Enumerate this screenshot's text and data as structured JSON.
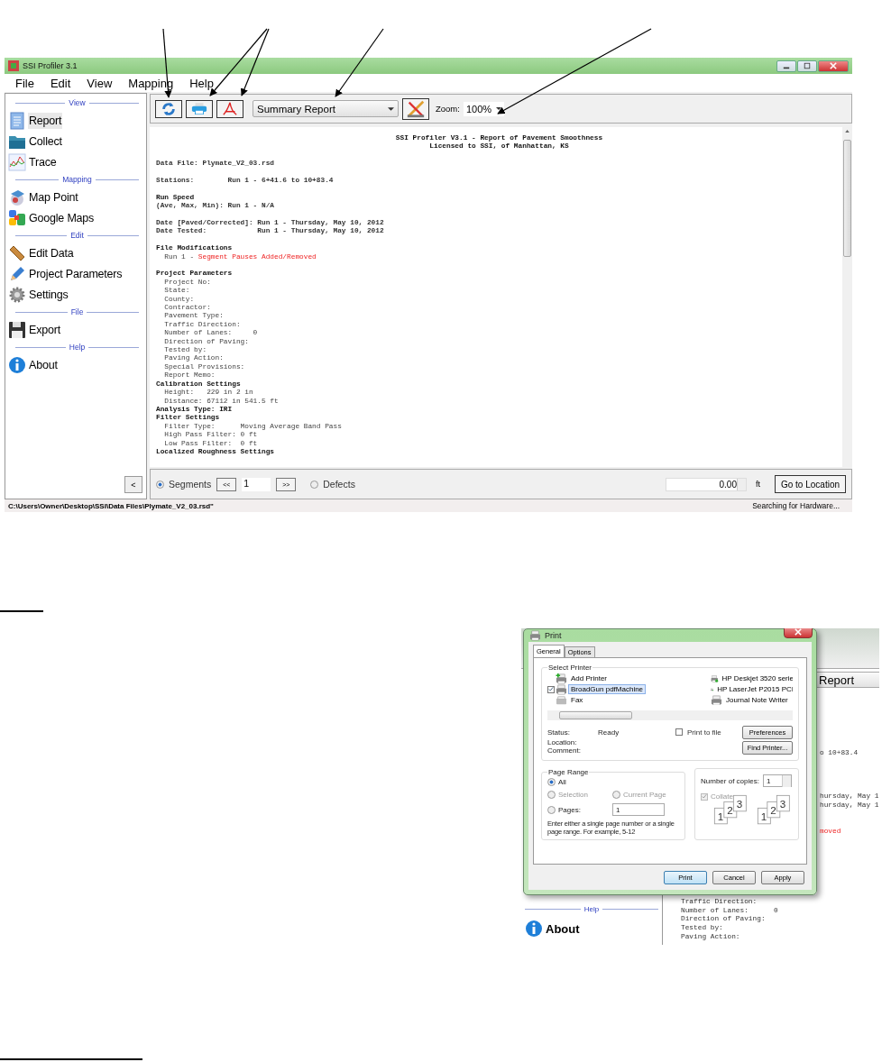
{
  "window": {
    "title": "SSI Profiler 3.1"
  },
  "menu": [
    "File",
    "Edit",
    "View",
    "Mapping",
    "Help"
  ],
  "sidebar": {
    "sections": [
      {
        "title": "View",
        "items": [
          {
            "label": "Report",
            "kind": "document",
            "selected": true
          },
          {
            "label": "Collect",
            "kind": "folder",
            "selected": false
          },
          {
            "label": "Trace",
            "kind": "chart",
            "selected": false
          }
        ]
      },
      {
        "title": "Mapping",
        "items": [
          {
            "label": "Map Point",
            "kind": "globe",
            "selected": false
          },
          {
            "label": "Google Maps",
            "kind": "blocks",
            "selected": false
          }
        ]
      },
      {
        "title": "Edit",
        "items": [
          {
            "label": "Edit Data",
            "kind": "ruler",
            "selected": false
          },
          {
            "label": "Project Parameters",
            "kind": "pencil",
            "selected": false
          },
          {
            "label": "Settings",
            "kind": "gear",
            "selected": false
          }
        ]
      },
      {
        "title": "File",
        "items": [
          {
            "label": "Export",
            "kind": "floppy",
            "selected": false
          }
        ]
      },
      {
        "title": "Help",
        "items": [
          {
            "label": "About",
            "kind": "info",
            "selected": false
          }
        ]
      }
    ],
    "collapse_button": "<"
  },
  "toolbar": {
    "buttons": [
      {
        "kind": "refresh"
      },
      {
        "kind": "print"
      },
      {
        "kind": "pdf"
      }
    ],
    "report_select": "Summary Report",
    "tool_button": {
      "kind": "drafting"
    },
    "zoom_label": "Zoom:",
    "zoom_value": "100%"
  },
  "report": {
    "blocks": [
      {
        "lines": [
          {
            "kind": "title",
            "text": "SSI Profiler V3.1 - Report of Pavement Smoothness"
          },
          {
            "kind": "title",
            "text": "Licensed to SSI, of Manhattan, KS"
          }
        ]
      },
      {
        "lines": [
          {
            "kind": "line",
            "text": "Data File: Plymate_V2_03.rsd"
          }
        ]
      },
      {
        "lines": [
          {
            "kind": "line",
            "text": "Stations:        Run 1 - 6+41.6 to 10+83.4"
          }
        ]
      },
      {
        "lines": [
          {
            "kind": "heading",
            "text": "Run Speed"
          },
          {
            "kind": "line",
            "text": "(Ave, Max, Min): Run 1 - N/A"
          }
        ]
      },
      {
        "lines": [
          {
            "kind": "line",
            "text": "Date [Paved/Corrected]: Run 1 - Thursday, May 10, 2012"
          },
          {
            "kind": "line",
            "text": "Date Tested:            Run 1 - Thursday, May 10, 2012"
          }
        ]
      },
      {
        "lines": [
          {
            "kind": "heading",
            "text": "File Modifications"
          },
          {
            "kind": "sub",
            "text": "Run 1 - ",
            "flag": "Segment Pauses Added/Removed"
          }
        ]
      },
      {
        "lines": [
          {
            "kind": "heading",
            "text": "Project Parameters"
          },
          {
            "kind": "sub",
            "text": "Project No:"
          },
          {
            "kind": "sub",
            "text": "State:"
          },
          {
            "kind": "sub",
            "text": "County:"
          },
          {
            "kind": "sub",
            "text": "Contractor:"
          },
          {
            "kind": "sub",
            "text": "Pavement Type:"
          },
          {
            "kind": "sub",
            "text": "Traffic Direction:"
          },
          {
            "kind": "sub",
            "text": "Number of Lanes:     0"
          },
          {
            "kind": "sub",
            "text": "Direction of Paving:"
          },
          {
            "kind": "sub",
            "text": "Tested by:"
          },
          {
            "kind": "sub",
            "text": "Paving Action:"
          },
          {
            "kind": "sub",
            "text": "Special Provisions:"
          },
          {
            "kind": "sub",
            "text": "Report Memo:"
          },
          {
            "kind": "heading",
            "text": "Calibration Settings"
          },
          {
            "kind": "sub",
            "text": "Height:   229 in 2 in"
          },
          {
            "kind": "sub",
            "text": "Distance: 67112 in 541.5 ft"
          },
          {
            "kind": "heading",
            "text": "Analysis Type: IRI"
          },
          {
            "kind": "heading",
            "text": "Filter Settings"
          },
          {
            "kind": "sub",
            "text": "Filter Type:      Moving Average Band Pass"
          },
          {
            "kind": "sub",
            "text": "High Pass Filter: 0 ft"
          },
          {
            "kind": "sub",
            "text": "Low Pass Filter:  0 ft"
          },
          {
            "kind": "heading",
            "text": "Localized Roughness Settings"
          }
        ]
      }
    ]
  },
  "navigation": {
    "segments": {
      "label": "Segments",
      "selected": true
    },
    "prev": "<<",
    "page": "1",
    "next": ">>",
    "defects": {
      "label": "Defects",
      "selected": false
    },
    "location": "0.00",
    "unit": "ft",
    "go_button": "Go to Location"
  },
  "status_bar": {
    "path": "C:\\Users\\Owner\\Desktop\\SSI\\Data Files\\Plymate_V2_03.rsd\"",
    "status": "Searching for Hardware..."
  },
  "print_screenshot": {
    "app": {
      "report_select": "Report",
      "fragments": [
        {
          "text": "o 10+83.4",
          "flagged": false
        },
        {
          "text": "hursday, May 1",
          "flagged": false
        },
        {
          "text": "hursday, May 1",
          "flagged": false
        },
        {
          "text": "moved",
          "flagged": true
        }
      ],
      "help_label": "Help",
      "about_label": "About",
      "lines": [
        "Traffic Direction:",
        "Number of Lanes:      0",
        "Direction of Paving:",
        "Tested by:",
        "Paving Action:"
      ]
    },
    "dialog": {
      "title": "Print",
      "tabs": [
        {
          "label": "General",
          "selected": true
        },
        {
          "label": "Options",
          "selected": false
        }
      ],
      "printer_group": "Select Printer",
      "printers": [
        {
          "label": "Add Printer",
          "kind": "add",
          "selected": false,
          "default": false
        },
        {
          "label": "BroadGun pdfMachine",
          "kind": "printer",
          "selected": true,
          "default": true
        },
        {
          "label": "Fax",
          "kind": "fax",
          "selected": false,
          "default": false
        },
        {
          "label": "HP Deskjet 3520 serie",
          "kind": "network",
          "selected": false,
          "default": false
        },
        {
          "label": "HP LaserJet P2015 PCI",
          "kind": "network",
          "selected": false,
          "default": false
        },
        {
          "label": "Journal Note Writer",
          "kind": "printer",
          "selected": false,
          "default": false
        }
      ],
      "info": [
        {
          "label": "Status:",
          "value": "Ready"
        },
        {
          "label": "Location:"
        },
        {
          "label": "Comment:"
        }
      ],
      "print_to_file": {
        "label": "Print to file",
        "checked": false
      },
      "preferences": "Preferences",
      "find_printer": "Find Printer...",
      "page_range": {
        "title": "Page Range",
        "options": [
          {
            "label": "All",
            "selected": true,
            "disabled": false
          },
          {
            "label": "Selection",
            "selected": false,
            "disabled": true
          },
          {
            "label": "Current Page",
            "selected": false,
            "disabled": true
          },
          {
            "label": "Pages:",
            "selected": false,
            "disabled": false
          }
        ],
        "pages_value": "1",
        "hint": "Enter either a single page number or a single page range.  For example, 5-12"
      },
      "copies": {
        "label": "Number of copies:",
        "value": "1",
        "collate": {
          "label": "Collate",
          "checked": true,
          "disabled": true
        },
        "collate_stacks": [
          [
            "1",
            "2",
            "3"
          ],
          [
            "1",
            "2",
            "3"
          ]
        ]
      },
      "buttons": [
        {
          "label": "Print",
          "default": true
        },
        {
          "label": "Cancel",
          "default": false
        },
        {
          "label": "Apply",
          "default": false
        }
      ]
    }
  }
}
